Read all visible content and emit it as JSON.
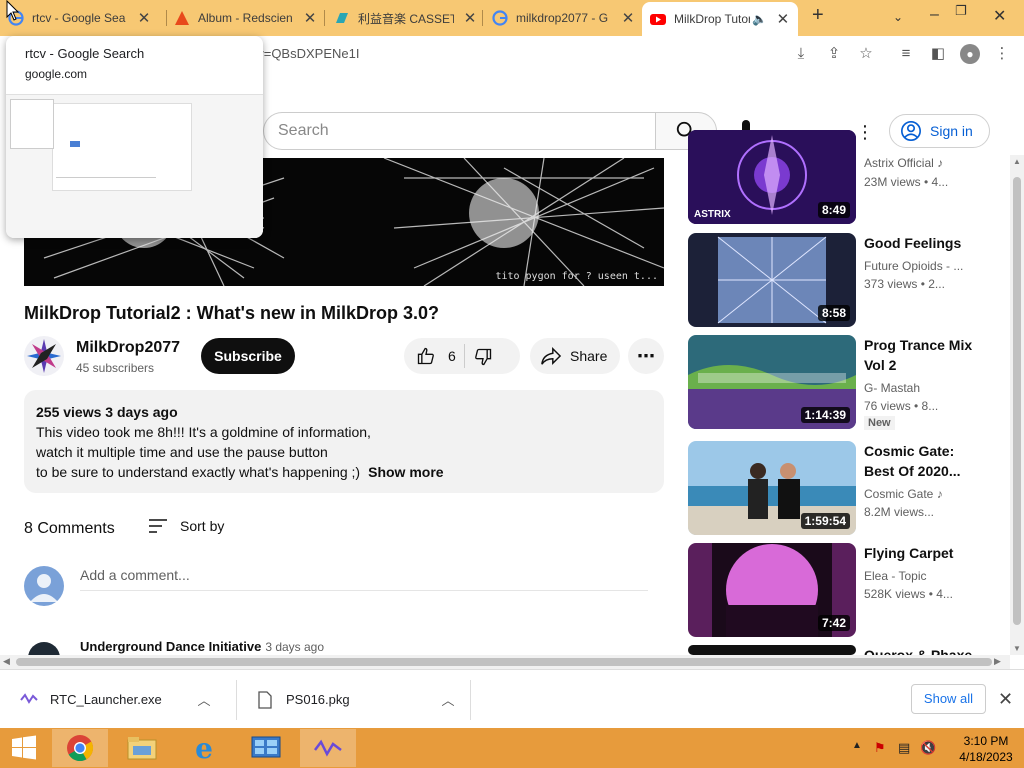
{
  "tabs": [
    {
      "title": "rtcv - Google Sea",
      "icon": "google-icon"
    },
    {
      "title": "Album - Redscien",
      "icon": "redscience-icon"
    },
    {
      "title": "利益音楽 CASSET",
      "icon": "cassette-icon"
    },
    {
      "title": "milkdrop2077 - G",
      "icon": "google-icon"
    },
    {
      "title": "MilkDrop Tutori",
      "icon": "youtube-icon",
      "active": true
    }
  ],
  "address": {
    "url": "?v=QBsDXPENe1I"
  },
  "hovercard": {
    "title": "rtcv - Google Search",
    "url": "google.com"
  },
  "header": {
    "search_placeholder": "Search",
    "signin": "Sign in"
  },
  "video": {
    "title": "MilkDrop Tutorial2 : What's new in MilkDrop 3.0?",
    "channel": "MilkDrop2077",
    "subscribers": "45 subscribers",
    "subscribe": "Subscribe",
    "likes": "6",
    "share": "Share",
    "overlay_text": "tito pygon for ? useen t..."
  },
  "description": {
    "meta": "255 views  3 days ago",
    "lines": [
      "This video took me 8h!!! It's a goldmine of information,",
      "watch it multiple time and use the pause button",
      "to be sure to understand exactly what's happening ;)"
    ],
    "show_more": "Show more"
  },
  "comments": {
    "count": "8 Comments",
    "sort": "Sort by",
    "placeholder": "Add a comment...",
    "first_author": "Underground Dance Initiative",
    "first_time": "3 days ago"
  },
  "recommendations": [
    {
      "title": "",
      "channel": "Astrix Official",
      "meta": "23M views  •  4...",
      "duration": "8:49",
      "bg": "#3a1a6e",
      "thumb_text": "ASTRIX"
    },
    {
      "title": "Good Feelings",
      "channel": "Future Opioids - ...",
      "meta": "373 views  •  2...",
      "duration": "8:58",
      "bg": "#2a2f4a"
    },
    {
      "title": "Prog Trance Mix Vol 2",
      "channel": "G- Mastah",
      "meta": "76 views  •  8...",
      "duration": "1:14:39",
      "bg": "#3b7a5e",
      "badge": "New"
    },
    {
      "title": "Cosmic Gate: Best Of 2020...",
      "channel": "Cosmic Gate",
      "meta": "8.2M views...",
      "duration": "1:59:54",
      "bg": "#7fb5d6"
    },
    {
      "title": "Flying Carpet",
      "channel": "Elea - Topic",
      "meta": "528K views  •  4...",
      "duration": "7:42",
      "bg": "#6a2a6a"
    },
    {
      "title": "Querox & Phaxe",
      "channel": "",
      "meta": "",
      "duration": "",
      "bg": "#111111"
    }
  ],
  "downloads": [
    {
      "name": "RTC_Launcher.exe",
      "icon": "app-icon"
    },
    {
      "name": "PS016.pkg",
      "icon": "file-icon"
    }
  ],
  "shelf": {
    "show_all": "Show all"
  },
  "taskbar": {
    "apps": [
      "start-icon",
      "chrome-icon",
      "explorer-icon",
      "ie-icon",
      "control-panel-icon",
      "milkdrop-icon"
    ],
    "time": "3:10 PM",
    "date": "4/18/2023"
  },
  "colors": {
    "tabbar": "#f7c873",
    "taskbar": "#e79b3c",
    "youtube_red": "#ff0000",
    "link_blue": "#065fd4"
  }
}
